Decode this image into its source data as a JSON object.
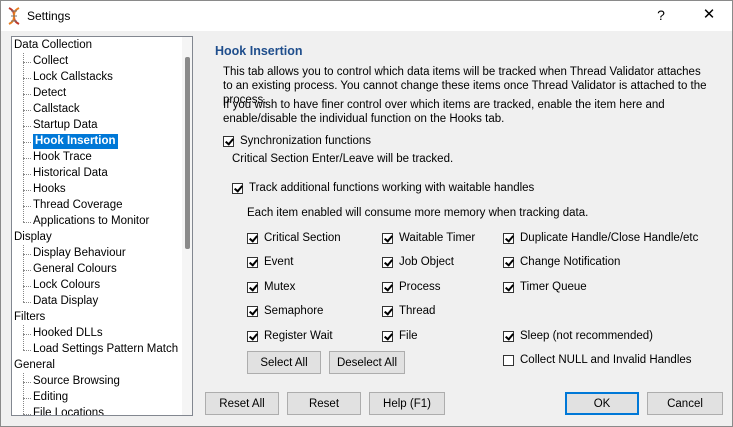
{
  "window": {
    "title": "Settings",
    "help_glyph": "?",
    "close_glyph": "✕"
  },
  "tree": {
    "items": [
      {
        "label": "Data Collection",
        "level": 0
      },
      {
        "label": "Collect",
        "level": 1
      },
      {
        "label": "Lock Callstacks",
        "level": 1
      },
      {
        "label": "Detect",
        "level": 1
      },
      {
        "label": "Callstack",
        "level": 1
      },
      {
        "label": "Startup Data",
        "level": 1
      },
      {
        "label": "Hook Insertion",
        "level": 1,
        "selected": true
      },
      {
        "label": "Hook Trace",
        "level": 1
      },
      {
        "label": "Historical Data",
        "level": 1
      },
      {
        "label": "Hooks",
        "level": 1
      },
      {
        "label": "Thread Coverage",
        "level": 1
      },
      {
        "label": "Applications to Monitor",
        "level": 1
      },
      {
        "label": "Display",
        "level": 0
      },
      {
        "label": "Display Behaviour",
        "level": 1
      },
      {
        "label": "General Colours",
        "level": 1
      },
      {
        "label": "Lock Colours",
        "level": 1
      },
      {
        "label": "Data Display",
        "level": 1
      },
      {
        "label": "Filters",
        "level": 0
      },
      {
        "label": "Hooked DLLs",
        "level": 1
      },
      {
        "label": "Load Settings Pattern Match",
        "level": 1
      },
      {
        "label": "General",
        "level": 0
      },
      {
        "label": "Source Browsing",
        "level": 1
      },
      {
        "label": "Editing",
        "level": 1
      },
      {
        "label": "File Locations",
        "level": 1
      }
    ]
  },
  "panel": {
    "title": "Hook Insertion",
    "para1": "This tab allows you to control which data items will be tracked when Thread Validator attaches to an existing process. You cannot change these items once Thread Validator is attached to the process.",
    "para2": "If you wish to have finer control over which items are tracked, enable the item here and enable/disable the individual function on the Hooks tab.",
    "sync_label": "Synchronization functions",
    "sync_checked": true,
    "sync_note": "Critical Section Enter/Leave will be tracked.",
    "waitable_label": "Track additional functions working with waitable handles",
    "waitable_checked": true,
    "waitable_note": "Each item enabled will consume more memory when tracking data.",
    "items": {
      "critical_section": {
        "label": "Critical Section",
        "checked": true
      },
      "event": {
        "label": "Event",
        "checked": true
      },
      "mutex": {
        "label": "Mutex",
        "checked": true
      },
      "semaphore": {
        "label": "Semaphore",
        "checked": true
      },
      "register_wait": {
        "label": "Register Wait",
        "checked": true
      },
      "waitable_timer": {
        "label": "Waitable Timer",
        "checked": true
      },
      "job_object": {
        "label": "Job Object",
        "checked": true
      },
      "process": {
        "label": "Process",
        "checked": true
      },
      "thread": {
        "label": "Thread",
        "checked": true
      },
      "file": {
        "label": "File",
        "checked": true
      },
      "duplicate_handle": {
        "label": "Duplicate Handle/Close Handle/etc",
        "checked": true
      },
      "change_notification": {
        "label": "Change Notification",
        "checked": true
      },
      "timer_queue": {
        "label": "Timer Queue",
        "checked": true
      },
      "sleep": {
        "label": "Sleep (not recommended)",
        "checked": true
      },
      "collect_null": {
        "label": "Collect NULL and Invalid Handles",
        "checked": false
      }
    },
    "select_all": "Select All",
    "deselect_all": "Deselect All"
  },
  "footer": {
    "reset_all": "Reset All",
    "reset": "Reset",
    "help": "Help (F1)",
    "ok": "OK",
    "cancel": "Cancel"
  }
}
